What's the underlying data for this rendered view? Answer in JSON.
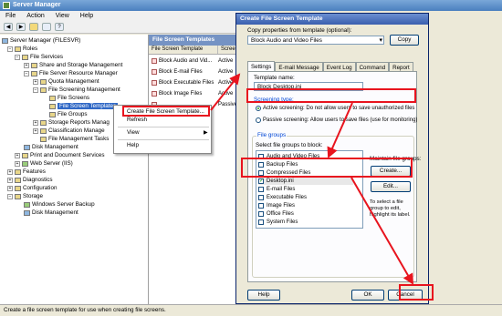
{
  "window": {
    "title": "Server Manager"
  },
  "menu": [
    "File",
    "Action",
    "View",
    "Help"
  ],
  "toolbar_icons": [
    "back-icon",
    "forward-icon",
    "folder-icon",
    "properties-icon",
    "help-icon"
  ],
  "tree": {
    "server": "Server Manager (FILESVR)",
    "roles": "Roles",
    "file_services": "File Services",
    "share_storage": "Share and Storage Management",
    "fsrm": "File Server Resource Manager",
    "quota": "Quota Management",
    "fsm": "File Screening Management",
    "file_screens": "File Screens",
    "file_screen_templates": "File Screen Templates",
    "file_groups": "File Groups",
    "storage_reports": "Storage Reports Manag",
    "classification": "Classification Manage",
    "file_mgmt_tasks": "File Management Tasks",
    "disk_mgmt_roles": "Disk Management",
    "print_doc": "Print and Document Services",
    "web_server": "Web Server (IIS)",
    "features": "Features",
    "diagnostics": "Diagnostics",
    "configuration": "Configuration",
    "storage": "Storage",
    "wsb": "Windows Server Backup",
    "disk_mgmt": "Disk Management"
  },
  "list": {
    "header": "File Screen Templates",
    "col_template": "File Screen Template",
    "col_type": "Scree",
    "rows": [
      {
        "name": "Block Audio and Vid...",
        "type": "Active"
      },
      {
        "name": "Block E-mail Files",
        "type": "Active"
      },
      {
        "name": "Block Executable Files",
        "type": "Active"
      },
      {
        "name": "Block Image Files",
        "type": "Active"
      },
      {
        "name": "",
        "type": "Passive"
      }
    ]
  },
  "context_menu": {
    "create": "Create File Screen Template...",
    "refresh": "Refresh",
    "view": "View",
    "help": "Help"
  },
  "dialog": {
    "title": "Create File Screen Template",
    "copy_label": "Copy properties from template (optional):",
    "copy_value": "Block Audio and Video Files",
    "copy_button": "Copy",
    "tabs": [
      "Settings",
      "E-mail Message",
      "Event Log",
      "Command",
      "Report"
    ],
    "template_name_label": "Template name:",
    "template_name_value": "Block Desktop.ini",
    "screening_type_label": "Screening type:",
    "active_option": "Active screening: Do not allow users to save unauthorized files",
    "passive_option": "Passive screening: Allow users to save files (use for monitoring)",
    "file_groups_label": "File groups",
    "select_label": "Select file groups to block:",
    "file_groups": [
      {
        "name": "Audio and Video Files",
        "checked": false
      },
      {
        "name": "Backup Files",
        "checked": false
      },
      {
        "name": "Compressed Files",
        "checked": false
      },
      {
        "name": "Desktop.ini",
        "checked": true
      },
      {
        "name": "E-mail Files",
        "checked": false
      },
      {
        "name": "Executable Files",
        "checked": false
      },
      {
        "name": "Image Files",
        "checked": false
      },
      {
        "name": "Office Files",
        "checked": false
      },
      {
        "name": "System Files",
        "checked": false
      }
    ],
    "maintain_label": "Maintain file groups:",
    "create_button": "Create...",
    "edit_button": "Edit...",
    "hint": "To select a file group to edit, highlight its label.",
    "help_button": "Help",
    "ok_button": "OK",
    "cancel_button": "Cancel"
  },
  "status_bar": "Create a file screen template for use when creating file screens.",
  "annotation_color": "#e8141e"
}
